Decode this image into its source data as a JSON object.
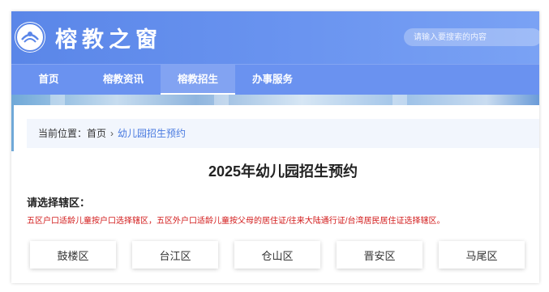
{
  "header": {
    "logo_text": "榕教之窗",
    "search_placeholder": "请输入要搜索的内容"
  },
  "nav": {
    "items": [
      {
        "label": "首页",
        "active": false
      },
      {
        "label": "榕教资讯",
        "active": false
      },
      {
        "label": "榕教招生",
        "active": true
      },
      {
        "label": "办事服务",
        "active": false
      }
    ]
  },
  "breadcrumb": {
    "prefix": "当前位置：",
    "home": "首页",
    "separator": "›",
    "current": "幼儿园招生预约"
  },
  "main": {
    "title": "2025年幼儿园招生预约",
    "district_prompt": "请选择辖区：",
    "notice": "五区户口适龄儿童按户口选择辖区，五区外户口适龄儿童按父母的居住证/往来大陆通行证/台湾居民居住证选择辖区。",
    "districts": [
      "鼓楼区",
      "台江区",
      "仓山区",
      "晋安区",
      "马尾区"
    ]
  },
  "colors": {
    "header_blue": "#6a92f0",
    "notice_red": "#d21a1a",
    "breadcrumb_link": "#4a7be0"
  }
}
